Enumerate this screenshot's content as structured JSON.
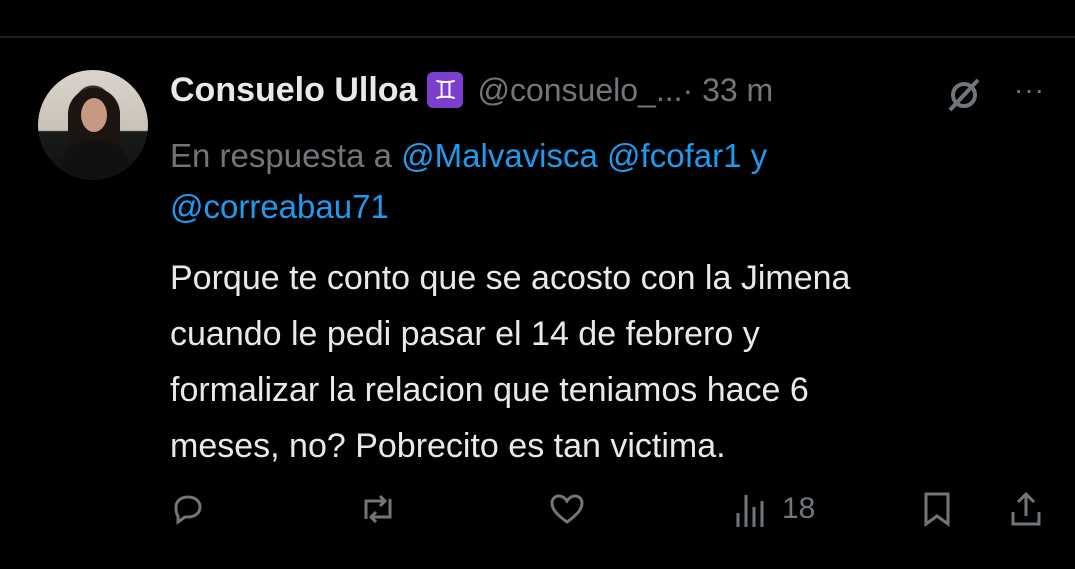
{
  "tweet": {
    "author_name": "Consuelo Ulloa",
    "badge_symbol": "♊",
    "handle": "@consuelo_...",
    "time": "· 33 m",
    "reply_prefix": "En respuesta a ",
    "reply_mention_1": "@Malvavisca",
    "reply_mention_2": "@fcofar1",
    "reply_conj": "y",
    "reply_mention_3": "@correabau71",
    "text_line_1": "Porque te conto que se acosto con la Jimena",
    "text_line_2": "cuando le pedi pasar el 14 de febrero y",
    "text_line_3": "formalizar la relacion que teniamos hace 6",
    "text_line_4": "meses, no? Pobrecito es tan victima.",
    "more_label": "···",
    "views_count": "18"
  },
  "icons": {
    "grok": "grok-icon",
    "reply": "reply-icon",
    "retweet": "retweet-icon",
    "like": "heart-icon",
    "views": "views-icon",
    "bookmark": "bookmark-icon",
    "share": "share-icon"
  },
  "colors": {
    "background": "#000000",
    "text": "#e7e9ea",
    "muted": "#71767b",
    "link": "#1d9bf0",
    "badge": "#7b3fd0"
  }
}
